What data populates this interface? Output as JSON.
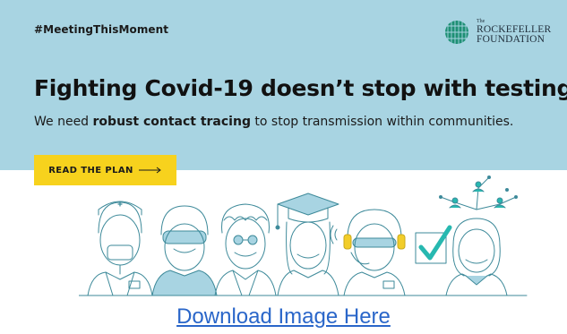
{
  "banner": {
    "hashtag": "#MeetingThisMoment",
    "logo": {
      "the": "The",
      "line1": "ROCKEFELLER",
      "line2": "FOUNDATION"
    },
    "headline": "Fighting Covid-19 doesn’t stop with testing.",
    "subline": {
      "prefix": "We need ",
      "bold": "robust contact tracing",
      "suffix": " to stop transmission within communities."
    },
    "cta_label": "READ THE PLAN"
  },
  "download_link": "Download Image Here",
  "colors": {
    "banner_bg": "#a8d4e2",
    "cta_bg": "#f7d21d",
    "illustration_stroke": "#3e8a9a",
    "accent_teal": "#27b8b0",
    "accent_yellow": "#f2cd2a",
    "link": "#2a66c9"
  },
  "icons": [
    "globe-logo-icon",
    "arrow-right-icon",
    "checkmark-icon",
    "network-people-icon"
  ]
}
